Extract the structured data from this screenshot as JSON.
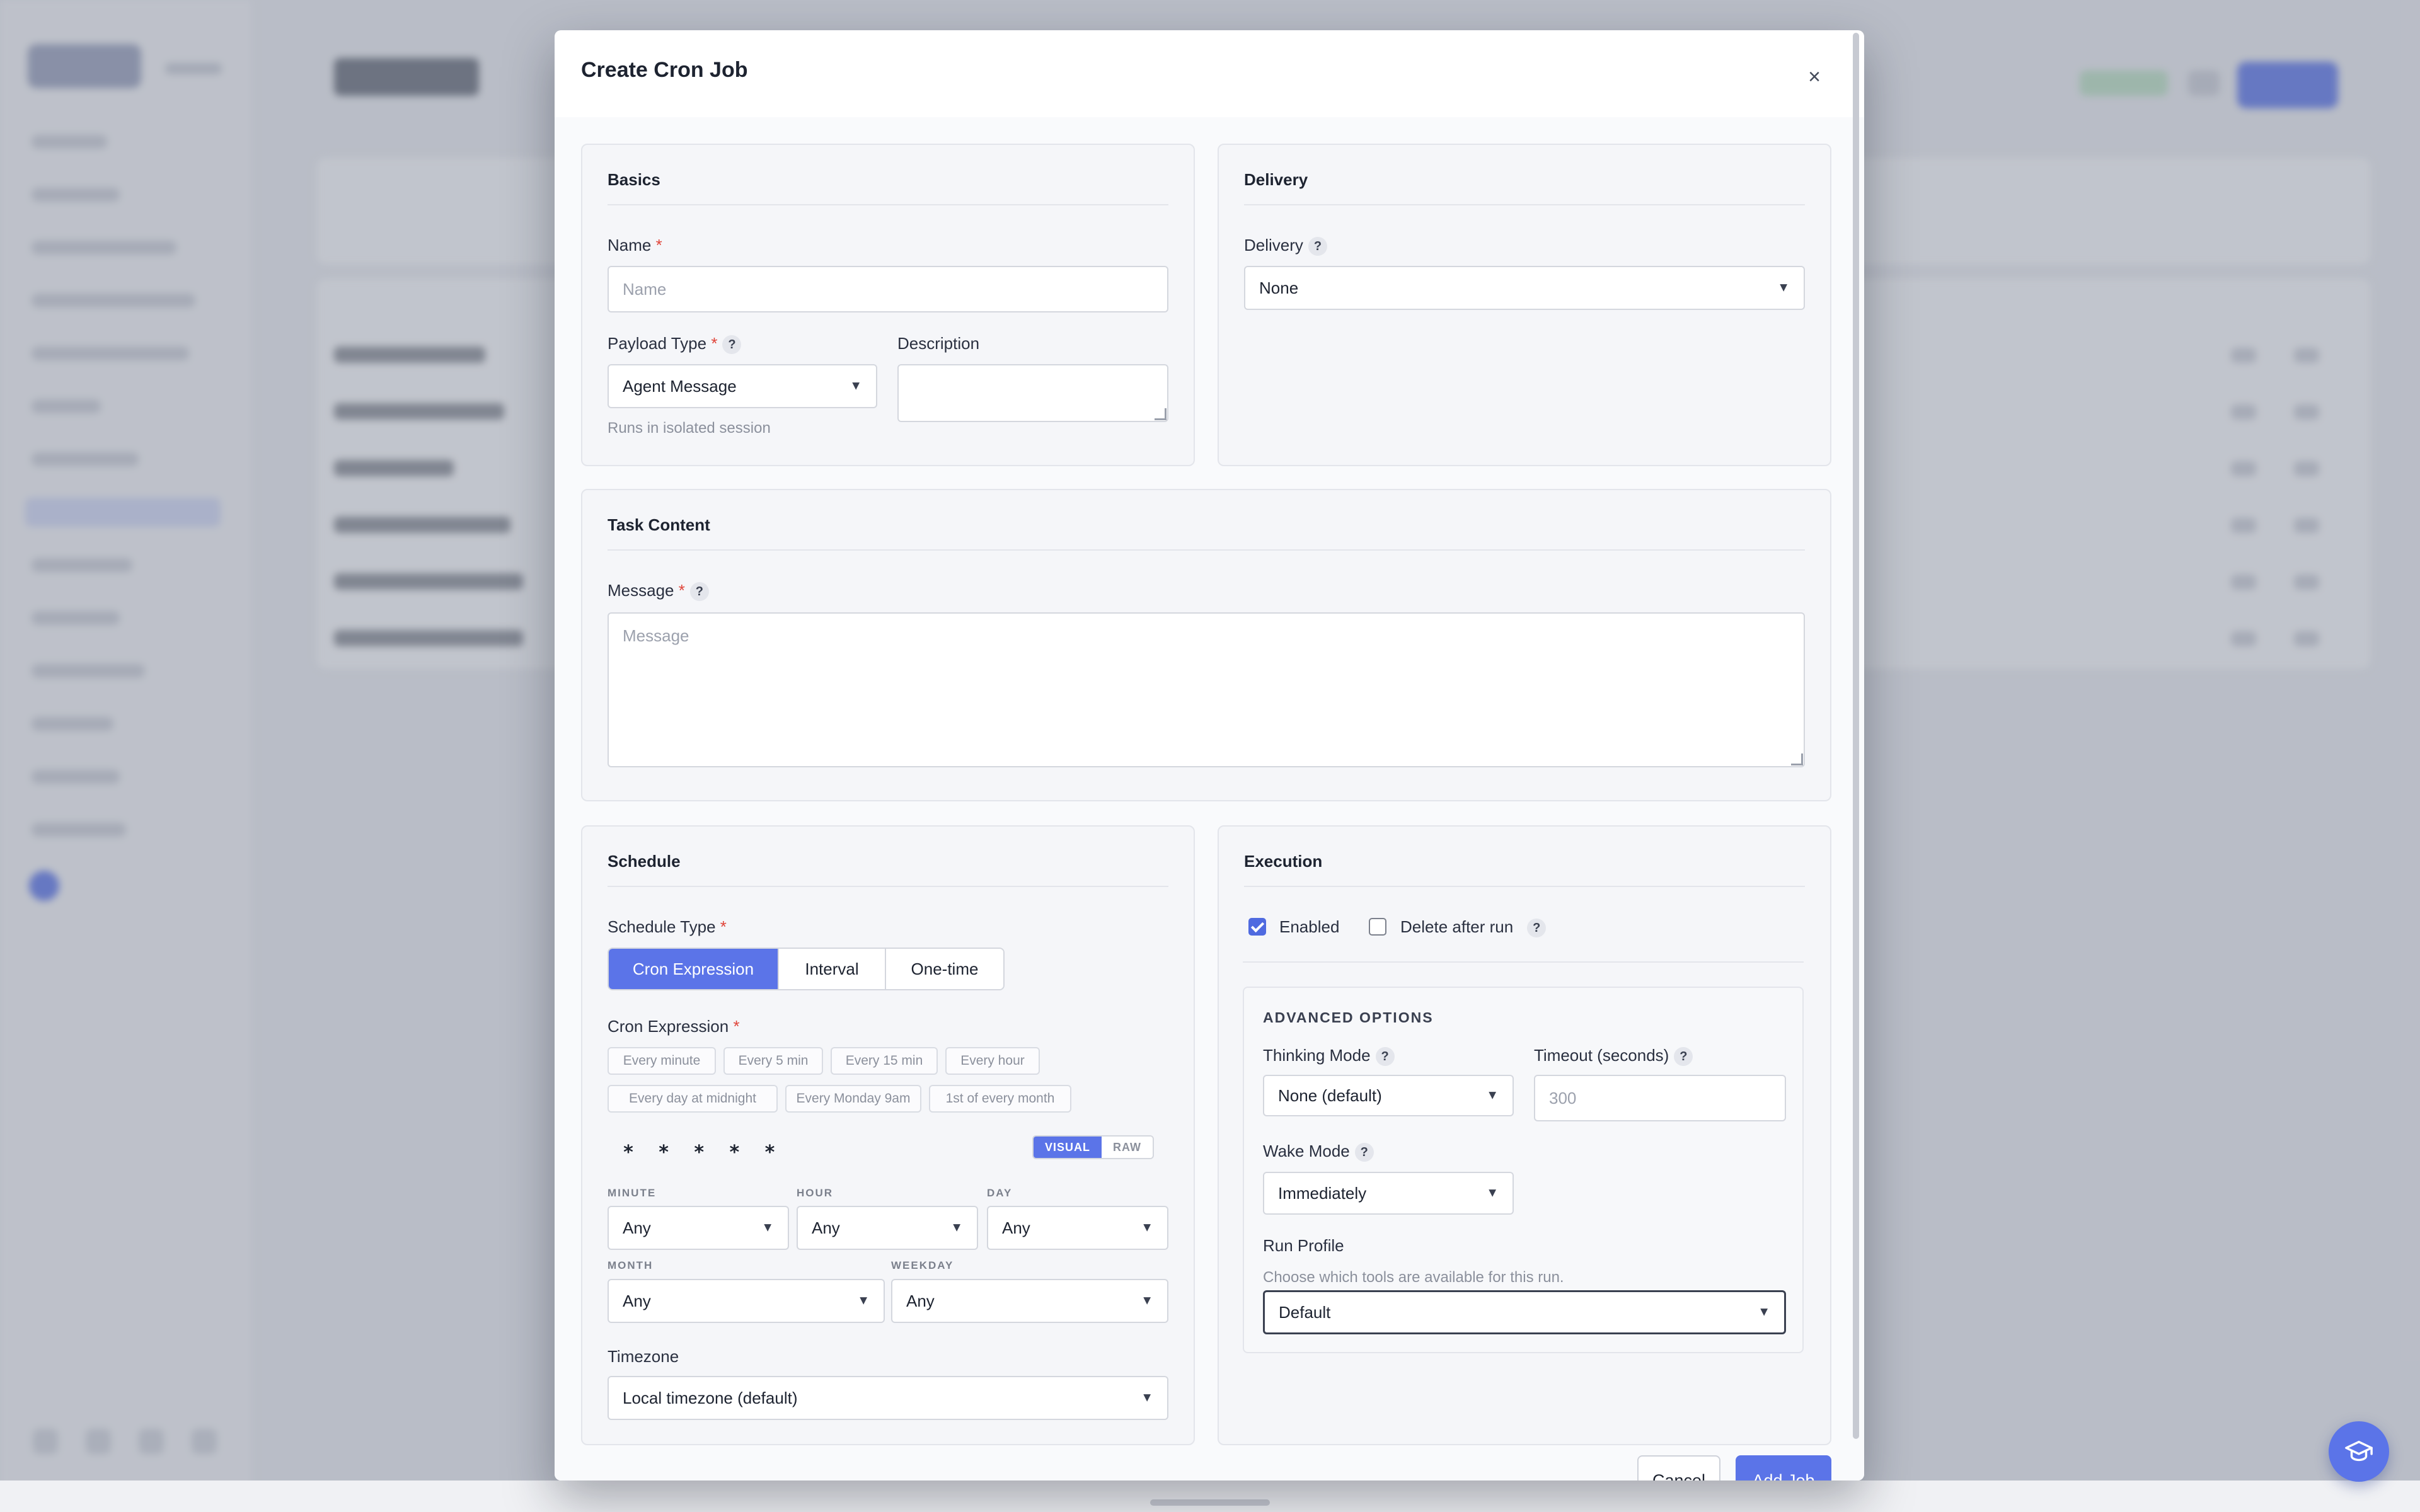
{
  "modal": {
    "title": "Create Cron Job",
    "close_glyph": "×"
  },
  "basics": {
    "title": "Basics",
    "name_label": "Name",
    "name_placeholder": "Name",
    "payload_label": "Payload Type",
    "payload_value": "Agent Message",
    "payload_hint": "Runs in isolated session",
    "description_label": "Description",
    "required_mark": "*",
    "help_glyph": "?"
  },
  "delivery": {
    "title": "Delivery",
    "label": "Delivery",
    "value": "None"
  },
  "task": {
    "title": "Task Content",
    "message_label": "Message",
    "message_placeholder": "Message"
  },
  "schedule": {
    "title": "Schedule",
    "type_label": "Schedule Type",
    "types": [
      "Cron Expression",
      "Interval",
      "One-time"
    ],
    "selected_type": "Cron Expression",
    "cron_label": "Cron Expression",
    "presets": [
      "Every minute",
      "Every 5 min",
      "Every 15 min",
      "Every hour",
      "Every day at midnight",
      "Every Monday 9am",
      "1st of every month"
    ],
    "preview": "* * * * *",
    "mode_visual": "VISUAL",
    "mode_raw": "RAW",
    "minute_label": "MINUTE",
    "minute_value": "Any",
    "hour_label": "HOUR",
    "hour_value": "Any",
    "day_label": "DAY",
    "day_value": "Any",
    "month_label": "MONTH",
    "month_value": "Any",
    "weekday_label": "WEEKDAY",
    "weekday_value": "Any",
    "timezone_label": "Timezone",
    "timezone_value": "Local timezone (default)"
  },
  "execution": {
    "title": "Execution",
    "enabled_label": "Enabled",
    "enabled": true,
    "delete_label": "Delete after run",
    "delete_after_run": false,
    "advanced_title": "ADVANCED OPTIONS",
    "thinking_label": "Thinking Mode",
    "thinking_value": "None (default)",
    "timeout_label": "Timeout (seconds)",
    "timeout_placeholder": "300",
    "wake_label": "Wake Mode",
    "wake_value": "Immediately",
    "profile_label": "Run Profile",
    "profile_hint": "Choose which tools are available for this run.",
    "profile_value": "Default"
  },
  "footer": {
    "cancel": "Cancel",
    "add": "Add Job"
  },
  "icons": {
    "caret": "▼",
    "help_fab": "graduation-cap-icon"
  },
  "colors": {
    "accent": "#5b74e8",
    "required": "#e0453a"
  }
}
